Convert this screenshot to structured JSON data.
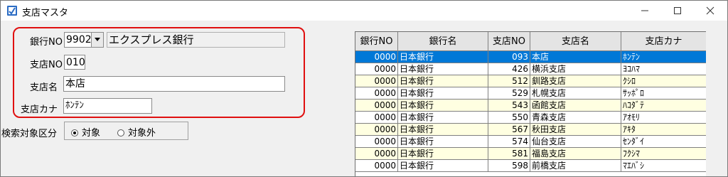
{
  "window": {
    "title": "支店マスタ"
  },
  "form": {
    "bank_no_label": "銀行NO",
    "bank_no_value": "9902",
    "bank_name_value": "エクスプレス銀行",
    "branch_no_label": "支店NO",
    "branch_no_value": "010",
    "branch_name_label": "支店名",
    "branch_name_value": "本店",
    "branch_kana_label": "支店カナ",
    "branch_kana_value": "ﾎﾝﾃﾝ"
  },
  "search": {
    "label": "検索対象区分",
    "options": [
      {
        "label": "対象",
        "selected": true
      },
      {
        "label": "対象外",
        "selected": false
      }
    ]
  },
  "grid": {
    "columns": [
      "銀行NO",
      "銀行名",
      "支店NO",
      "支店名",
      "支店カナ"
    ],
    "rows": [
      {
        "bank_no": "0000",
        "bank_name": "日本銀行",
        "branch_no": "093",
        "branch_name": "本店",
        "kana": "ﾎﾝﾃﾝ",
        "selected": true
      },
      {
        "bank_no": "0000",
        "bank_name": "日本銀行",
        "branch_no": "426",
        "branch_name": "横浜支店",
        "kana": "ﾖｺﾊﾏ",
        "selected": false
      },
      {
        "bank_no": "0000",
        "bank_name": "日本銀行",
        "branch_no": "512",
        "branch_name": "釧路支店",
        "kana": "ｸｼﾛ",
        "selected": false
      },
      {
        "bank_no": "0000",
        "bank_name": "日本銀行",
        "branch_no": "529",
        "branch_name": "札幌支店",
        "kana": "ｻｯﾎﾟﾛ",
        "selected": false
      },
      {
        "bank_no": "0000",
        "bank_name": "日本銀行",
        "branch_no": "543",
        "branch_name": "函館支店",
        "kana": "ﾊｺﾀﾞﾃ",
        "selected": false
      },
      {
        "bank_no": "0000",
        "bank_name": "日本銀行",
        "branch_no": "550",
        "branch_name": "青森支店",
        "kana": "ｱｵﾓﾘ",
        "selected": false
      },
      {
        "bank_no": "0000",
        "bank_name": "日本銀行",
        "branch_no": "567",
        "branch_name": "秋田支店",
        "kana": "ｱｷﾀ",
        "selected": false
      },
      {
        "bank_no": "0000",
        "bank_name": "日本銀行",
        "branch_no": "574",
        "branch_name": "仙台支店",
        "kana": "ｾﾝﾀﾞｲ",
        "selected": false
      },
      {
        "bank_no": "0000",
        "bank_name": "日本銀行",
        "branch_no": "581",
        "branch_name": "福島支店",
        "kana": "ﾌｸｼﾏ",
        "selected": false
      },
      {
        "bank_no": "0000",
        "bank_name": "日本銀行",
        "branch_no": "598",
        "branch_name": "前橋支店",
        "kana": "ﾏｴﾊﾞｼ",
        "selected": false
      }
    ]
  },
  "colors": {
    "selected_row": "#0078d7",
    "odd_row": "#ffffe1",
    "even_row": "#ffffff",
    "highlight_border": "#e01010"
  },
  "icons": [
    "app-icon",
    "minimize-icon",
    "maximize-icon",
    "close-icon",
    "dropdown-arrow-icon"
  ]
}
